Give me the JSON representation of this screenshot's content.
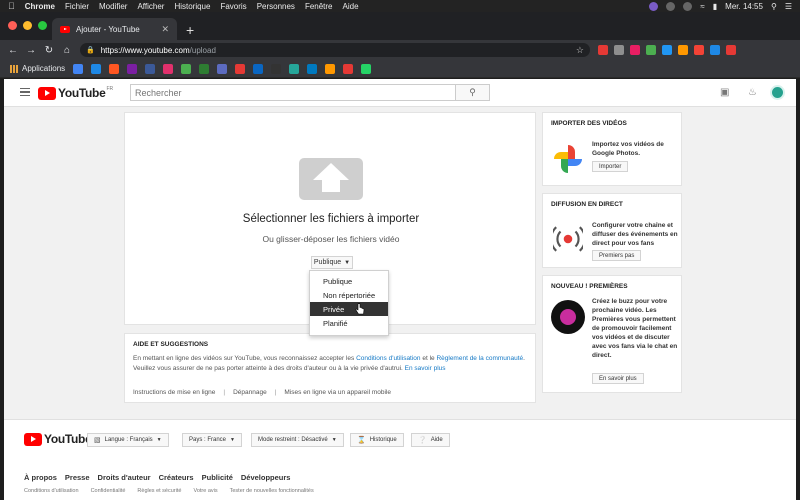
{
  "os_menu_bar": {
    "app_name": "Chrome",
    "menus": [
      "Fichier",
      "Modifier",
      "Afficher",
      "Historique",
      "Favoris",
      "Personnes",
      "Fenêtre",
      "Aide"
    ],
    "clock": "Mer. 14:55"
  },
  "browser": {
    "tab_title": "Ajouter - YouTube",
    "new_tab_glyph": "+",
    "url_host": "https://www.youtube.com",
    "url_path": "/upload",
    "bookmarks_apps_label": "Applications",
    "extension_colors": [
      "#e53935",
      "#8e8e8e",
      "#e91e63",
      "#4caf50",
      "#2196f3",
      "#ff9800",
      "#f44336",
      "#1e88e5",
      "#e53935"
    ],
    "bookmark_colors": [
      "#4285f4",
      "#1e88e5",
      "#ff5722",
      "#7b1fa2",
      "#3b5998",
      "#e1306c",
      "#4caf50",
      "#2e7d32",
      "#5c6bc0",
      "#e53935",
      "#0a66c2",
      "#333333",
      "#26a69a",
      "#0079bf",
      "#ff9800",
      "#e53935",
      "#25d366"
    ]
  },
  "header": {
    "logo_text": "YouTube",
    "logo_sup": "FR",
    "search_placeholder": "Rechercher",
    "icons": [
      "video-camera-icon",
      "bell-icon",
      "avatar"
    ]
  },
  "upload": {
    "title": "Sélectionner les fichiers à importer",
    "subtitle": "Ou glisser-déposer les fichiers vidéo",
    "privacy_selected": "Publique",
    "privacy_options": [
      {
        "label": "Publique",
        "active": false
      },
      {
        "label": "Non répertoriée",
        "active": false
      },
      {
        "label": "Privée",
        "active": true
      },
      {
        "label": "Planifié",
        "active": false
      }
    ]
  },
  "help": {
    "title": "AIDE ET SUGGESTIONS",
    "line1_pre": "En mettant en ligne des vidéos sur YouTube, vous reconnaissez accepter les ",
    "line1_link1": "Conditions d'utilisation",
    "line1_mid": " et le ",
    "line1_link2": "Règlement de la communauté",
    "line1_post": ".",
    "line2_pre": "Veuillez vous assurer de ne pas porter atteinte à des droits d'auteur ou à la vie privée d'autrui. ",
    "line2_link": "En savoir plus",
    "links": [
      "Instructions de mise en ligne",
      "Dépannage",
      "Mises en ligne via un appareil mobile"
    ]
  },
  "sidebar": {
    "import": {
      "title": "IMPORTER DES VIDÉOS",
      "text": "Importez vos vidéos de Google Photos.",
      "button": "Importer"
    },
    "live": {
      "title": "DIFFUSION EN DIRECT",
      "text": "Configurer votre chaîne et diffuser des événements en direct pour vos fans",
      "button": "Premiers pas"
    },
    "premieres": {
      "title": "NOUVEAU ! PREMIÈRES",
      "text": "Créez le buzz pour votre prochaine vidéo. Les Premières vous permettent de promouvoir facilement vos vidéos et de discuter avec vos fans via le chat en direct.",
      "button": "En savoir plus"
    }
  },
  "footer": {
    "language": "Langue : Français",
    "country": "Pays : France",
    "restricted": "Mode restreint : Désactivé",
    "history": "Historique",
    "help": "Aide",
    "links": [
      "À propos",
      "Presse",
      "Droits d'auteur",
      "Créateurs",
      "Publicité",
      "Développeurs"
    ],
    "sublinks": [
      "Conditions d'utilisation",
      "Confidentialité",
      "Règles et sécurité",
      "Votre avis",
      "Tester de nouvelles fonctionnalités"
    ]
  },
  "colors": {
    "accent_red": "#ff0000",
    "link_blue": "#167ac6",
    "menu_active_bg": "#333333"
  }
}
